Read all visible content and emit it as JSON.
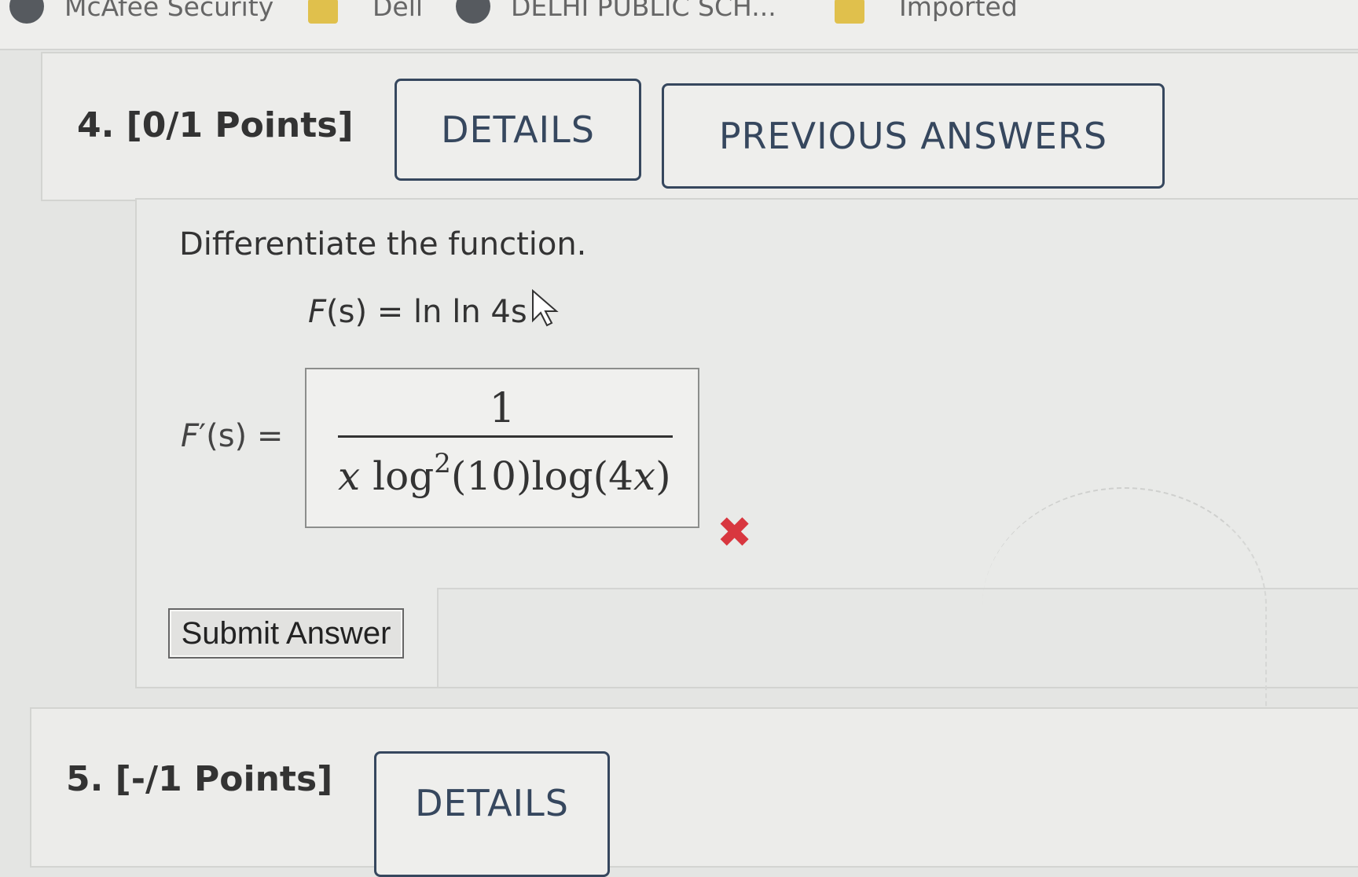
{
  "bookmarks": [
    {
      "label": "McAfee Security",
      "icon": "globe-icon"
    },
    {
      "label": "Dell",
      "icon": "folder-icon"
    },
    {
      "label": "DELHI PUBLIC SCH...",
      "icon": "globe-icon"
    },
    {
      "label": "Imported",
      "icon": "folder-icon"
    }
  ],
  "question4": {
    "header": "4. [0/1 Points]",
    "details_label": "DETAILS",
    "previous_answers_label": "PREVIOUS ANSWERS",
    "prompt": "Differentiate the function.",
    "function_name": "F",
    "function_var": "(s)",
    "function_rhs": " = ln ln 4s",
    "derivative_name": "F",
    "derivative_rest": "′(s) =",
    "answer": {
      "numerator": "1",
      "den_x": "x",
      "den_log1": " log",
      "den_exp": "2",
      "den_mid": "(10)log(4",
      "den_x2": "x",
      "den_close": ")"
    },
    "status": "incorrect",
    "status_color": "#d8373f",
    "submit_label": "Submit Answer"
  },
  "question5": {
    "header": "5. [-/1 Points]",
    "details_label": "DETAILS"
  }
}
